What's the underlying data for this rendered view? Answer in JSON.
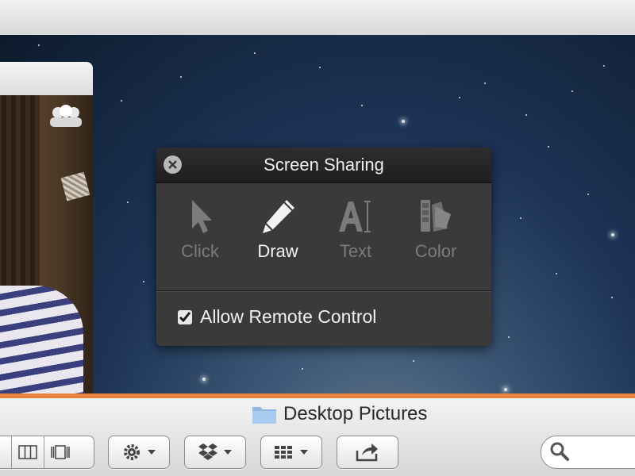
{
  "panel": {
    "title": "Screen Sharing",
    "tools": [
      {
        "label": "Click",
        "icon": "cursor-arrow-icon",
        "active": false
      },
      {
        "label": "Draw",
        "icon": "pencil-icon",
        "active": true
      },
      {
        "label": "Text",
        "icon": "text-tool-icon",
        "active": false
      },
      {
        "label": "Color",
        "icon": "color-swatch-icon",
        "active": false
      }
    ],
    "allow_remote_control": {
      "label": "Allow Remote Control",
      "checked": true
    }
  },
  "finder": {
    "window_title": "Desktop Pictures"
  },
  "colors": {
    "panel_bg": "#3a3a3a",
    "accent_orange": "#e8843a",
    "active_label": "#f4f4f4",
    "inactive_label": "#7b7b7b"
  }
}
